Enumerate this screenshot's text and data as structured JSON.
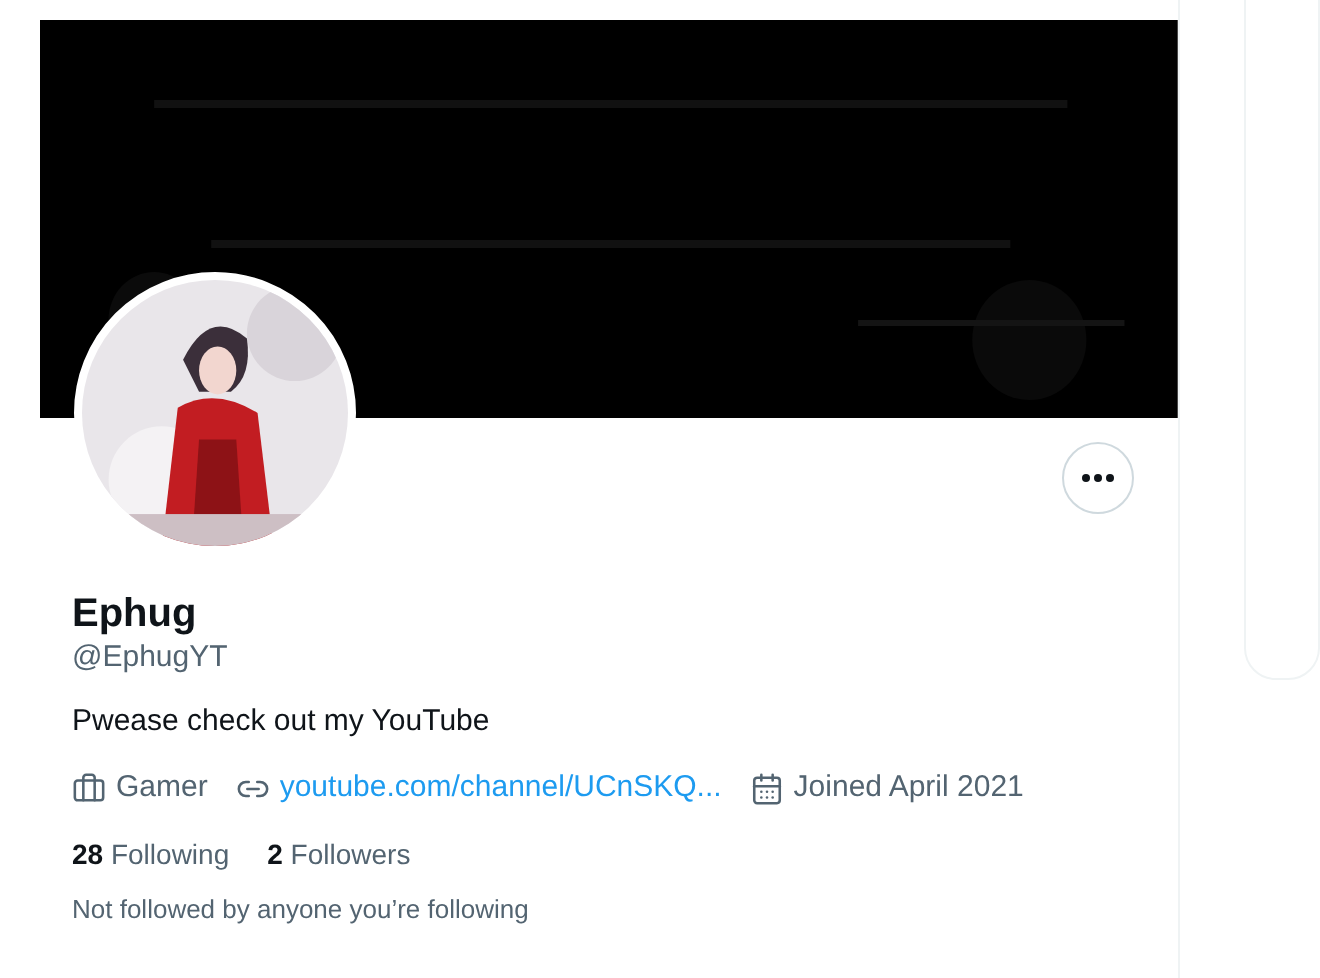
{
  "profile": {
    "name": "Ephug",
    "handle": "@EphugYT",
    "bio": "Pwease check out my YouTube",
    "meta": [
      {
        "kind": "work",
        "text": "Gamer"
      },
      {
        "kind": "link",
        "text": "youtube.com/channel/UCnSKQ..."
      },
      {
        "kind": "joined",
        "text": "Joined April 2021"
      }
    ],
    "stats": [
      {
        "count": "28",
        "label": "Following"
      },
      {
        "count": "2",
        "label": "Followers"
      }
    ],
    "note": "Not followed by anyone you’re following"
  }
}
